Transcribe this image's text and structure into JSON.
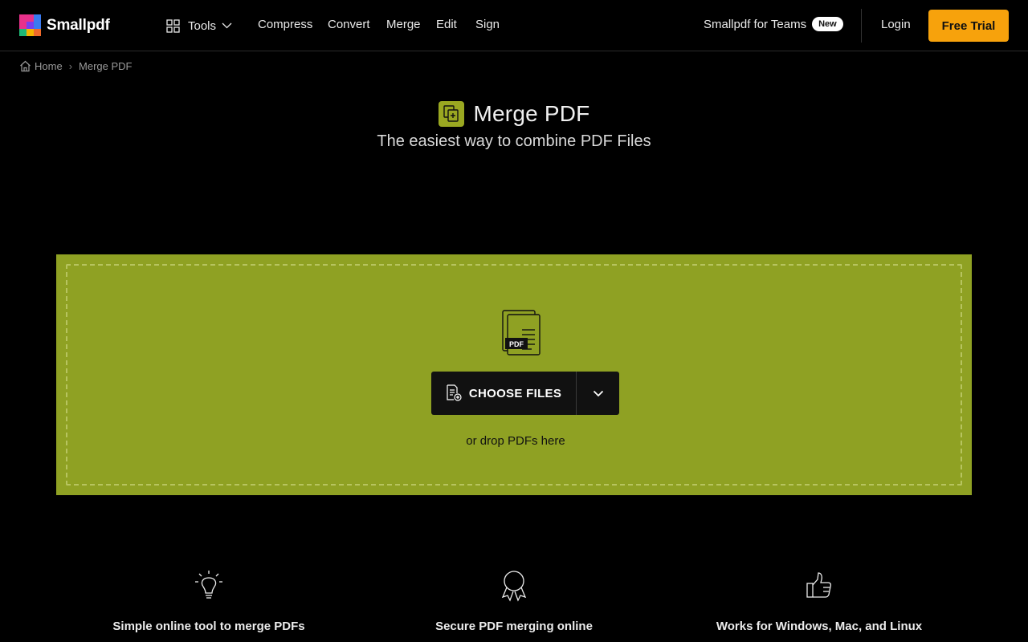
{
  "brand": {
    "name": "Smallpdf"
  },
  "nav": {
    "tools_label": "Tools",
    "links": [
      "Compress",
      "Convert",
      "Merge",
      "Edit",
      "Sign"
    ],
    "teams_label": "Smallpdf for Teams",
    "teams_badge": "New",
    "login_label": "Login",
    "trial_label": "Free Trial"
  },
  "breadcrumb": {
    "home": "Home",
    "current": "Merge PDF"
  },
  "hero": {
    "title": "Merge PDF",
    "subtitle": "The easiest way to combine PDF Files"
  },
  "dropzone": {
    "icon_text": "PDF",
    "choose_label": "CHOOSE FILES",
    "hint": "or drop PDFs here"
  },
  "features": [
    {
      "icon": "lightbulb-icon",
      "label": "Simple online tool to merge PDFs"
    },
    {
      "icon": "award-ribbon-icon",
      "label": "Secure PDF merging online"
    },
    {
      "icon": "thumbs-up-icon",
      "label": "Works for Windows, Mac, and Linux"
    }
  ],
  "colors": {
    "accent": "#8fa123",
    "tool_icon": "#9aa821",
    "cta": "#f7a20c",
    "background": "#000000"
  }
}
